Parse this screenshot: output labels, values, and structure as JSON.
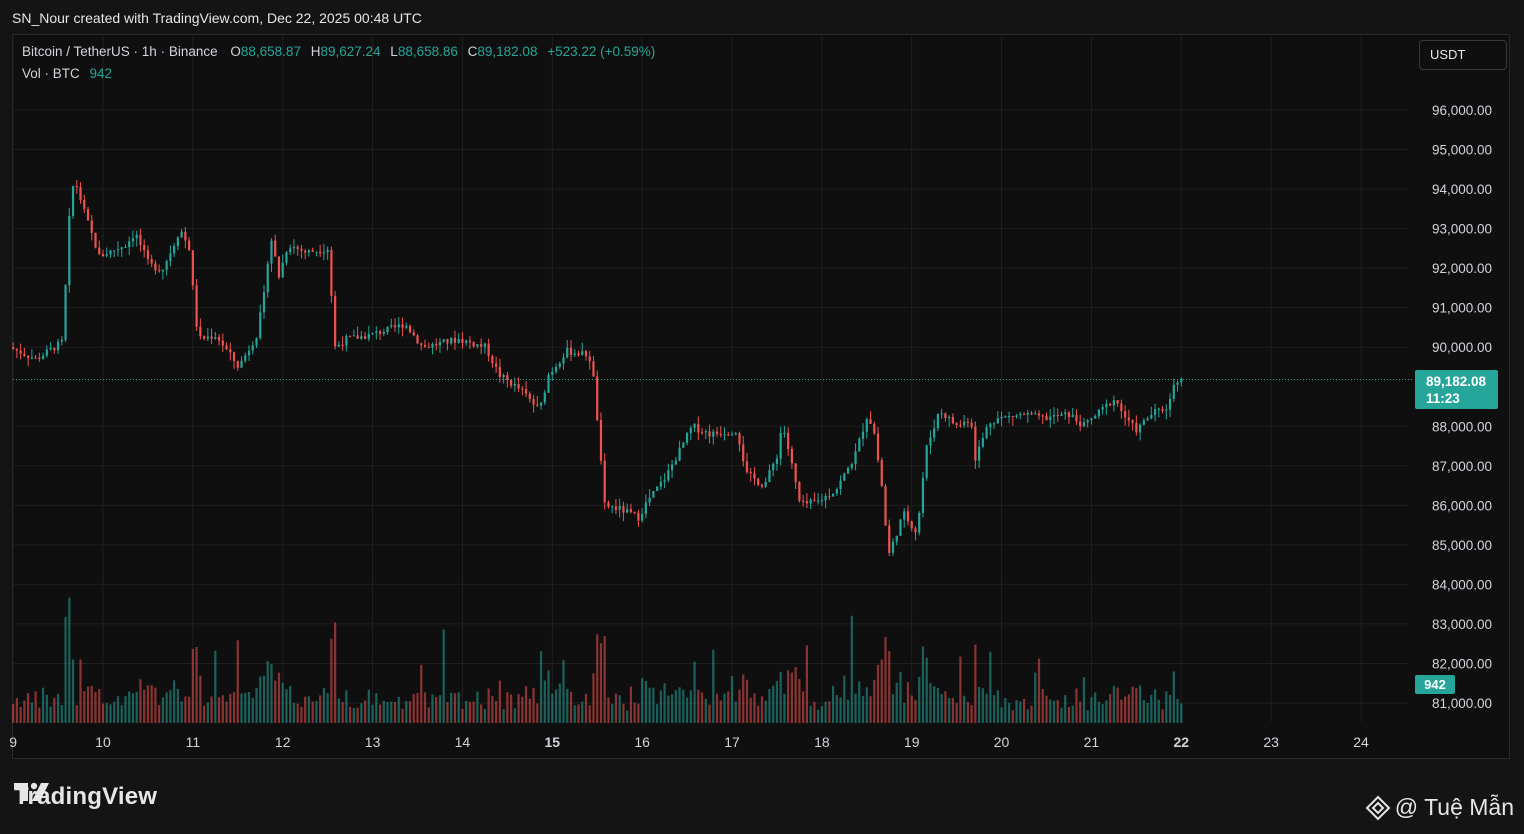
{
  "header": {
    "credit": "SN_Nour created with TradingView.com, Dec 22, 2025 00:48 UTC"
  },
  "legend": {
    "symbol": "Bitcoin / TetherUS · 1h · Binance",
    "o_label": "O",
    "o_value": "88,658.87",
    "h_label": "H",
    "h_value": "89,627.24",
    "l_label": "L",
    "l_value": "88,658.86",
    "c_label": "C",
    "c_value": "89,182.08",
    "change": "+523.22 (+0.59%)",
    "vol_label": "Vol · BTC",
    "vol_value": "942"
  },
  "currency_button": "USDT",
  "price_tag": {
    "price": "89,182.08",
    "countdown": "11:23"
  },
  "volume_tag": "942",
  "brand": {
    "name": "TradingView"
  },
  "author": {
    "name": "@ Tuệ Mẫn"
  },
  "colors": {
    "up": "#26a69a",
    "down": "#ef5350",
    "background": "#0f0f0f",
    "grid": "#1f1f1f",
    "text": "#d1d4dc"
  },
  "chart_data": {
    "type": "candlestick",
    "y_ticks": [
      "96,000.00",
      "95,000.00",
      "94,000.00",
      "93,000.00",
      "92,000.00",
      "91,000.00",
      "90,000.00",
      "88,000.00",
      "87,000.00",
      "86,000.00",
      "85,000.00",
      "84,000.00",
      "83,000.00",
      "82,000.00",
      "81,000.00"
    ],
    "y_tick_values": [
      96000,
      95000,
      94000,
      93000,
      92000,
      91000,
      90000,
      88000,
      87000,
      86000,
      85000,
      84000,
      83000,
      82000,
      81000
    ],
    "ylim": [
      80500,
      97000
    ],
    "x_ticks": [
      "9",
      "10",
      "11",
      "12",
      "13",
      "14",
      "15",
      "16",
      "17",
      "18",
      "19",
      "20",
      "21",
      "22",
      "23",
      "24"
    ],
    "x_tick_bold": [
      "15",
      "22"
    ],
    "x_tick_days": [
      9,
      10,
      11,
      12,
      13,
      14,
      15,
      16,
      17,
      18,
      19,
      20,
      21,
      22,
      23,
      24
    ],
    "last_price": 89182.08,
    "price_path": [
      [
        9.0,
        90000
      ],
      [
        9.3,
        89700
      ],
      [
        9.6,
        90150
      ],
      [
        9.65,
        92900
      ],
      [
        9.72,
        94300
      ],
      [
        9.85,
        93300
      ],
      [
        10.0,
        92300
      ],
      [
        10.3,
        92600
      ],
      [
        10.4,
        92900
      ],
      [
        10.55,
        92100
      ],
      [
        10.7,
        91950
      ],
      [
        10.85,
        92700
      ],
      [
        10.9,
        93000
      ],
      [
        11.0,
        92500
      ],
      [
        11.05,
        91300
      ],
      [
        11.1,
        90200
      ],
      [
        11.3,
        90300
      ],
      [
        11.55,
        89500
      ],
      [
        11.75,
        90300
      ],
      [
        11.85,
        91500
      ],
      [
        11.9,
        92900
      ],
      [
        12.0,
        91800
      ],
      [
        12.1,
        92600
      ],
      [
        12.3,
        92400
      ],
      [
        12.55,
        92500
      ],
      [
        12.62,
        90000
      ],
      [
        12.75,
        90200
      ],
      [
        13.0,
        90300
      ],
      [
        13.3,
        90500
      ],
      [
        13.4,
        90600
      ],
      [
        13.6,
        90000
      ],
      [
        13.8,
        90100
      ],
      [
        14.0,
        90200
      ],
      [
        14.3,
        90000
      ],
      [
        14.45,
        89300
      ],
      [
        14.7,
        88900
      ],
      [
        14.9,
        88400
      ],
      [
        15.0,
        89300
      ],
      [
        15.2,
        89900
      ],
      [
        15.45,
        89800
      ],
      [
        15.5,
        89200
      ],
      [
        15.55,
        88000
      ],
      [
        15.62,
        86000
      ],
      [
        15.8,
        85900
      ],
      [
        16.0,
        85700
      ],
      [
        16.1,
        86100
      ],
      [
        16.3,
        86700
      ],
      [
        16.6,
        88000
      ],
      [
        16.8,
        87800
      ],
      [
        17.1,
        87900
      ],
      [
        17.2,
        86800
      ],
      [
        17.4,
        86500
      ],
      [
        17.55,
        87300
      ],
      [
        17.6,
        88100
      ],
      [
        17.7,
        87100
      ],
      [
        17.8,
        86000
      ],
      [
        18.0,
        86100
      ],
      [
        18.2,
        86400
      ],
      [
        18.4,
        87200
      ],
      [
        18.55,
        88300
      ],
      [
        18.62,
        87900
      ],
      [
        18.72,
        86300
      ],
      [
        18.78,
        84700
      ],
      [
        18.95,
        85800
      ],
      [
        19.1,
        85300
      ],
      [
        19.2,
        87400
      ],
      [
        19.35,
        88400
      ],
      [
        19.55,
        88000
      ],
      [
        19.7,
        88200
      ],
      [
        19.75,
        87200
      ],
      [
        19.9,
        88100
      ],
      [
        20.0,
        88200
      ],
      [
        20.3,
        88300
      ],
      [
        20.5,
        88200
      ],
      [
        20.8,
        88300
      ],
      [
        20.95,
        88000
      ],
      [
        21.05,
        88200
      ],
      [
        21.3,
        88700
      ],
      [
        21.45,
        88100
      ],
      [
        21.55,
        87900
      ],
      [
        21.7,
        88300
      ],
      [
        21.9,
        88500
      ],
      [
        21.97,
        89200
      ],
      [
        22.0,
        89182
      ]
    ],
    "volume": {
      "last": 942,
      "scale_note": "volume bars at bottom pane"
    }
  }
}
